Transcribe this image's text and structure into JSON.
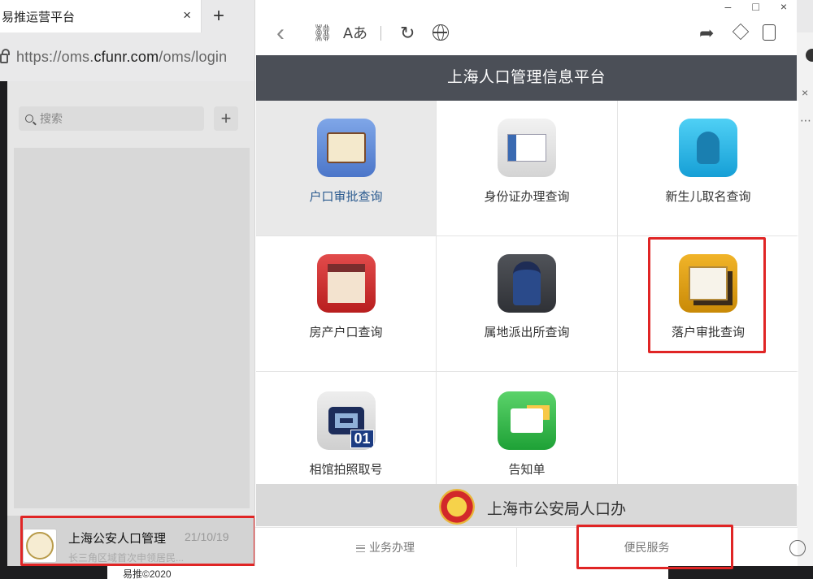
{
  "browser": {
    "tab_title": "易推运营平台",
    "tab_close": "×",
    "new_tab": "+",
    "url_prefix": "https://oms.",
    "url_domain": "cfunr.com",
    "url_path": "/oms/login"
  },
  "chat_list": {
    "search_placeholder": "搜索",
    "add_label": "+",
    "item": {
      "name": "上海公安人口管理",
      "time": "21/10/19",
      "preview": "长三角区域首次申领居民..."
    }
  },
  "miniprogram": {
    "window_controls": [
      "–",
      "□",
      "×"
    ],
    "toolbar": {
      "back": "‹",
      "font": "Aあ"
    },
    "header_title": "上海人口管理信息平台",
    "services": [
      {
        "label": "户口审批查询",
        "icon": "book-magnifier-icon",
        "active": true
      },
      {
        "label": "身份证办理查询",
        "icon": "id-card-magnifier-icon",
        "active": false
      },
      {
        "label": "新生儿取名查询",
        "icon": "baby-person-icon",
        "active": false
      },
      {
        "label": "房产户口查询",
        "icon": "house-magnifier-icon",
        "active": false
      },
      {
        "label": "属地派出所查询",
        "icon": "police-officer-icon",
        "active": false
      },
      {
        "label": "落户审批查询",
        "icon": "stamp-documents-icon",
        "active": false
      },
      {
        "label": "相馆拍照取号",
        "icon": "camera-number-icon",
        "badge": "01",
        "active": false
      },
      {
        "label": "告知单",
        "icon": "notice-pencil-icon",
        "active": false
      }
    ],
    "footer_org": "上海市公安局人口办",
    "bottom_nav": {
      "business": "业务办理",
      "service": "便民服务"
    }
  },
  "copyright": "易推©2020",
  "colors": {
    "header_bg": "#4b4f57",
    "highlight_red": "#e02525",
    "active_label": "#2a5a8f"
  }
}
